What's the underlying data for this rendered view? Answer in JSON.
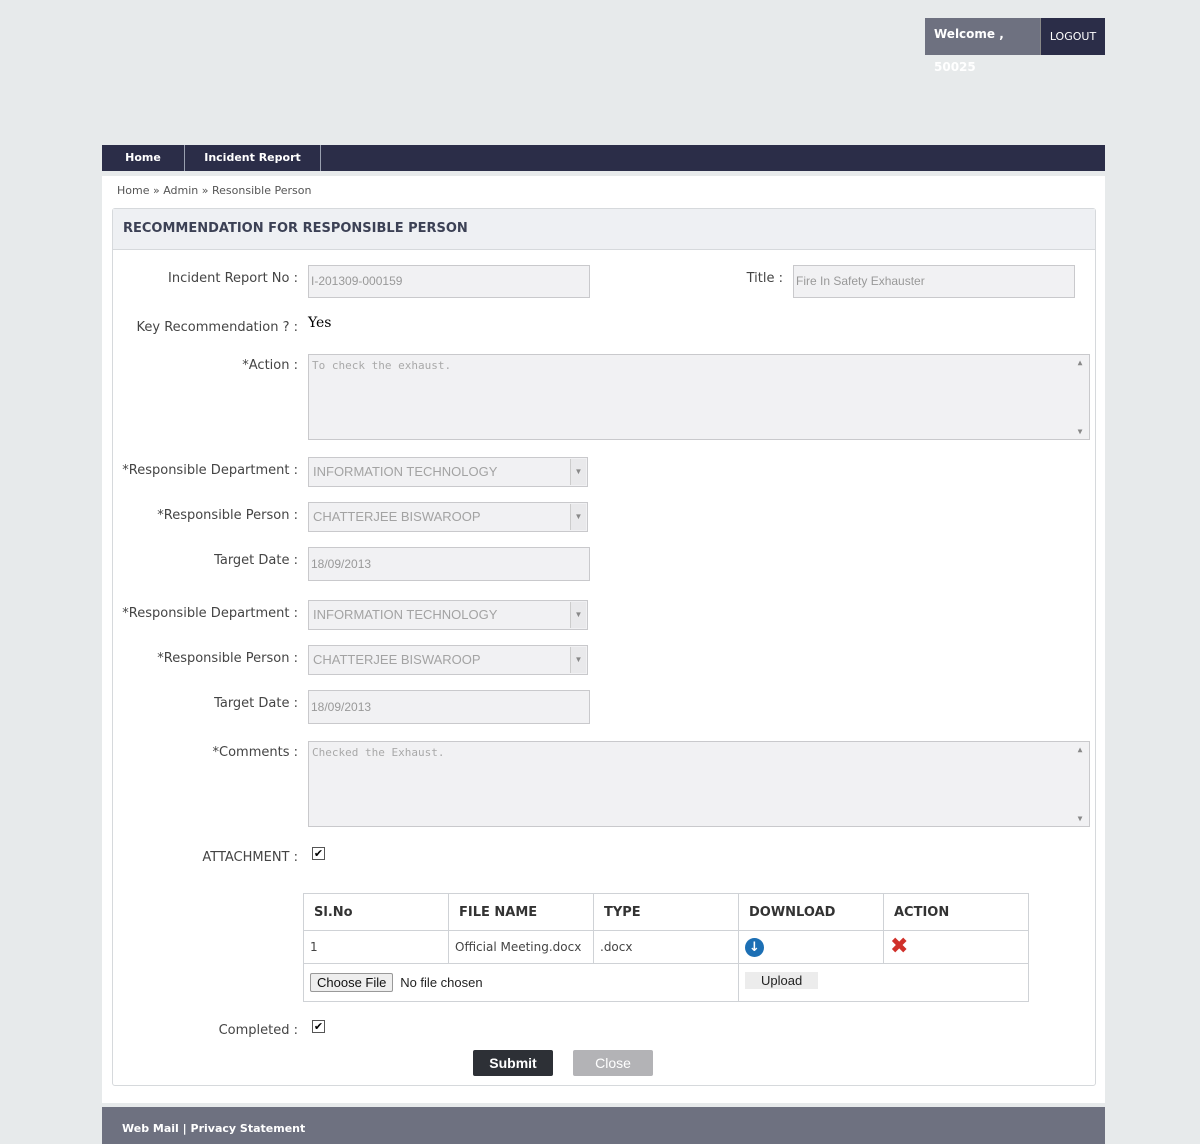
{
  "header": {
    "welcome": "Welcome , 50025",
    "logout": "LOGOUT"
  },
  "nav": {
    "home": "Home",
    "incident_report": "Incident Report"
  },
  "breadcrumb": {
    "home": "Home",
    "sep": "»",
    "admin": "Admin",
    "current": "Resonsible Person"
  },
  "panel": {
    "title": "RECOMMENDATION FOR RESPONSIBLE PERSON"
  },
  "form": {
    "incident_no_label": "Incident Report No :",
    "incident_no_value": "I-201309-000159",
    "title_label": "Title :",
    "title_value": "Fire In Safety Exhauster",
    "key_rec_label": "Key Recommendation ? :",
    "key_rec_value": "Yes",
    "action_label": "*Action :",
    "action_value": "To check the exhaust.",
    "resp_dept_label": "*Responsible Department :",
    "resp_dept_value": "INFORMATION TECHNOLOGY",
    "resp_person_label": "*Responsible Person :",
    "resp_person_value": "CHATTERJEE BISWAROOP",
    "target_date_label": "Target Date :",
    "target_date_value": "18/09/2013",
    "resp_dept2_value": "INFORMATION TECHNOLOGY",
    "resp_person2_value": "CHATTERJEE BISWAROOP",
    "target_date2_value": "18/09/2013",
    "comments_label": "*Comments :",
    "comments_value": "Checked the Exhaust.",
    "attachment_label": "ATTACHMENT :",
    "completed_label": "Completed :",
    "check_mark": "✔"
  },
  "attachments": {
    "headers": [
      "Sl.No",
      "FILE NAME",
      "TYPE",
      "DOWNLOAD",
      "ACTION"
    ],
    "rows": [
      {
        "no": "1",
        "file": "Official Meeting.docx",
        "type": ".docx"
      }
    ],
    "choose_file": "Choose File",
    "no_file": "No file chosen",
    "upload": "Upload"
  },
  "buttons": {
    "submit": "Submit",
    "close": "Close"
  },
  "footer": {
    "webmail": "Web Mail",
    "sep": "|",
    "privacy": "Privacy Statement"
  }
}
